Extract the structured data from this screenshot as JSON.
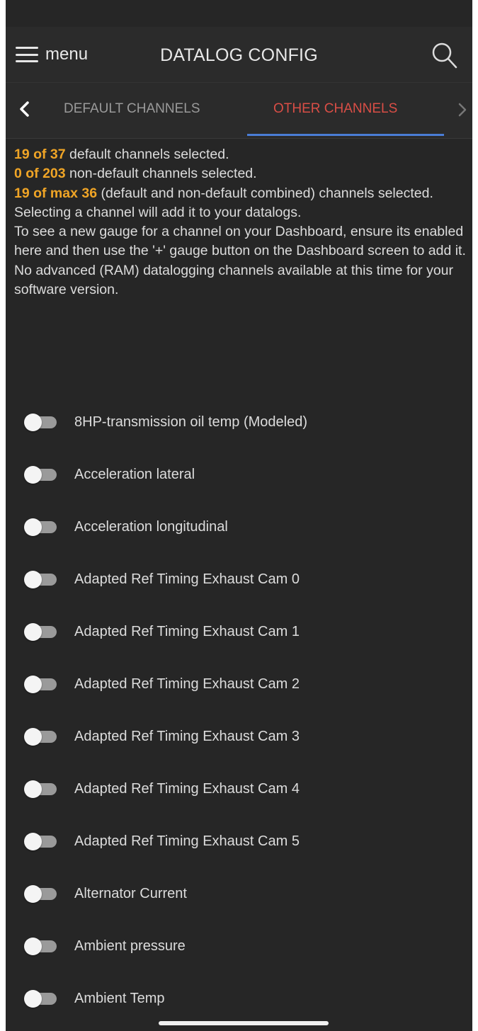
{
  "header": {
    "menu_label": "menu",
    "title": "DATALOG CONFIG",
    "menu_icon": "hamburger-icon",
    "search_icon": "search-icon"
  },
  "tabs": [
    {
      "label": "DEFAULT CHANNELS",
      "active": false
    },
    {
      "label": "OTHER CHANNELS",
      "active": true
    }
  ],
  "info": {
    "line1_count": "19 of 37",
    "line1_text": " default channels selected.",
    "line2_count": "0 of 203",
    "line2_text": " non-default channels selected.",
    "line3_count": "19 of max 36",
    "line3_text": " (default and non-default combined) channels selected.",
    "line4_text": "Selecting a channel will add it to your datalogs.",
    "line5_text": "To see a new gauge for a channel on your Dashboard, ensure its enabled here and then use the '+' gauge button on the Dashboard screen to add it.",
    "line6_text": "No advanced (RAM) datalogging channels available at this time for your software version."
  },
  "channels": [
    {
      "label": "8HP-transmission oil temp (Modeled)",
      "enabled": false
    },
    {
      "label": "Acceleration lateral",
      "enabled": false
    },
    {
      "label": "Acceleration longitudinal",
      "enabled": false
    },
    {
      "label": "Adapted Ref Timing Exhaust Cam 0",
      "enabled": false
    },
    {
      "label": "Adapted Ref Timing Exhaust Cam 1",
      "enabled": false
    },
    {
      "label": "Adapted Ref Timing Exhaust Cam 2",
      "enabled": false
    },
    {
      "label": "Adapted Ref Timing Exhaust Cam 3",
      "enabled": false
    },
    {
      "label": "Adapted Ref Timing Exhaust Cam 4",
      "enabled": false
    },
    {
      "label": "Adapted Ref Timing Exhaust Cam 5",
      "enabled": false
    },
    {
      "label": "Alternator Current",
      "enabled": false
    },
    {
      "label": "Ambient pressure",
      "enabled": false
    },
    {
      "label": "Ambient Temp",
      "enabled": false
    }
  ],
  "colors": {
    "background": "#262626",
    "highlight_number": "#f0a526",
    "active_tab": "#d94e46",
    "tab_underline": "#4a7dd6"
  }
}
